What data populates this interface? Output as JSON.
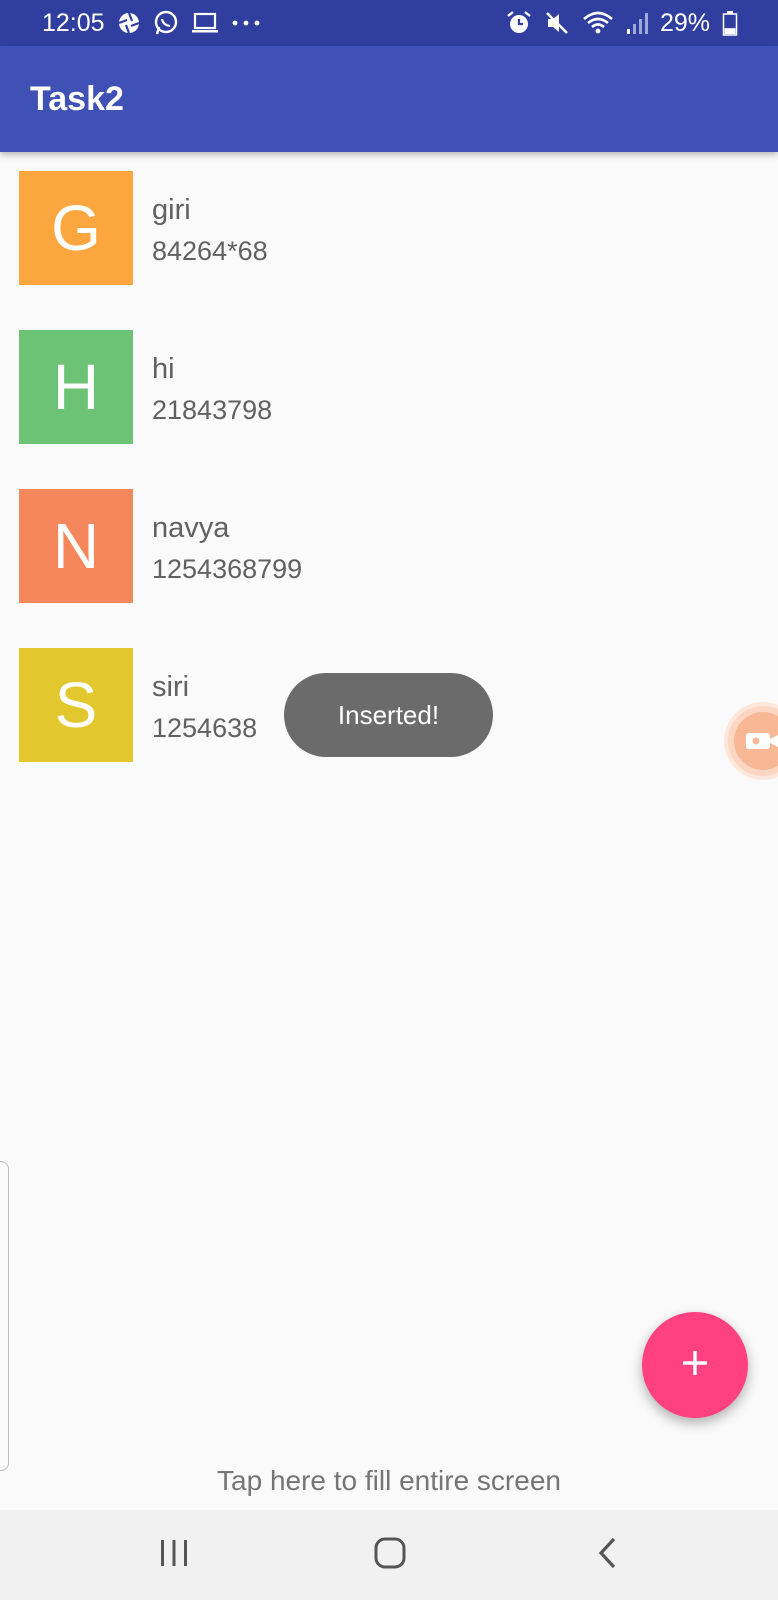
{
  "status_bar": {
    "time": "12:05",
    "left_icons": [
      "aperture-icon",
      "whatsapp-icon",
      "laptop-icon",
      "more-dots-icon"
    ],
    "right_icons": [
      "alarm-icon",
      "mute-icon",
      "wifi-icon",
      "signal-icon",
      "battery-icon"
    ],
    "battery_text": "29%",
    "battery_level": 0.29
  },
  "app_bar": {
    "title": "Task2",
    "color": "#3f51b5"
  },
  "contacts": [
    {
      "initial": "G",
      "name": "giri",
      "phone": "84264*68",
      "color": "#fba63f"
    },
    {
      "initial": "H",
      "name": "hi",
      "phone": "21843798",
      "color": "#6cc275"
    },
    {
      "initial": "N",
      "name": "navya",
      "phone": "1254368799",
      "color": "#f5875d"
    },
    {
      "initial": "S",
      "name": "siri",
      "phone": "1254638",
      "color": "#e3c72e"
    }
  ],
  "toast": {
    "message": "Inserted!"
  },
  "fab": {
    "icon": "plus-icon",
    "color": "#ff4081"
  },
  "fill_screen_hint": "Tap here to fill entire screen",
  "nav_bar": {
    "buttons": [
      "recents-icon",
      "home-icon",
      "back-icon"
    ]
  }
}
